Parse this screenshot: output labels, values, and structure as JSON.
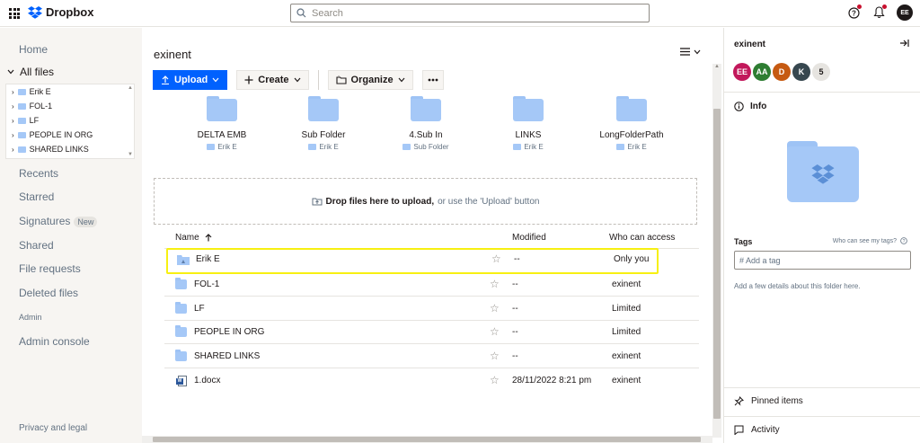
{
  "app": {
    "brand": "Dropbox",
    "accent": "#0061fe"
  },
  "search": {
    "placeholder": "Search"
  },
  "user": {
    "initials": "EE"
  },
  "sidebar": {
    "home": "Home",
    "all_files": "All files",
    "tree": [
      {
        "label": "Erik E"
      },
      {
        "label": "FOL-1"
      },
      {
        "label": "LF"
      },
      {
        "label": "PEOPLE IN ORG"
      },
      {
        "label": "SHARED LINKS"
      }
    ],
    "recents": "Recents",
    "starred": "Starred",
    "signatures": "Signatures",
    "signatures_badge": "New",
    "shared": "Shared",
    "file_requests": "File requests",
    "deleted_files": "Deleted files",
    "admin": "Admin",
    "admin_console": "Admin console",
    "privacy": "Privacy and legal"
  },
  "main": {
    "folder_title": "exinent",
    "toolbar": {
      "upload": "Upload",
      "create": "Create",
      "organize": "Organize"
    },
    "suggested": [
      {
        "name": "DELTA EMB",
        "sub": "Erik E"
      },
      {
        "name": "Sub Folder",
        "sub": "Erik E"
      },
      {
        "name": "4.Sub In",
        "sub": "Sub Folder"
      },
      {
        "name": "LINKS",
        "sub": "Erik E"
      },
      {
        "name": "LongFolderPath",
        "sub": "Erik E"
      }
    ],
    "dropzone": {
      "bold": "Drop files here to upload,",
      "rest": "or use the 'Upload' button"
    },
    "table": {
      "headers": {
        "name": "Name",
        "modified": "Modified",
        "access": "Who can access"
      },
      "rows": [
        {
          "name": "Erik E",
          "modified": "--",
          "access": "Only you"
        },
        {
          "name": "FOL-1",
          "modified": "--",
          "access": "exinent"
        },
        {
          "name": "LF",
          "modified": "--",
          "access": "Limited"
        },
        {
          "name": "PEOPLE IN ORG",
          "modified": "--",
          "access": "Limited"
        },
        {
          "name": "SHARED LINKS",
          "modified": "--",
          "access": "exinent"
        },
        {
          "name": "1.docx",
          "modified": "28/11/2022 8:21 pm",
          "access": "exinent"
        }
      ]
    }
  },
  "panel": {
    "title": "exinent",
    "members": [
      {
        "initials": "EE",
        "color": "#c2185b"
      },
      {
        "initials": "AA",
        "color": "#2e7d32"
      },
      {
        "initials": "D",
        "color": "#c65a11"
      },
      {
        "initials": "K",
        "color": "#37474f"
      }
    ],
    "member_count": "5",
    "info": "Info",
    "tags": "Tags",
    "tags_help": "Who can see my tags?",
    "tag_placeholder": "# Add a tag",
    "details": "Add a few details about this folder here.",
    "pinned": "Pinned items",
    "activity": "Activity"
  }
}
